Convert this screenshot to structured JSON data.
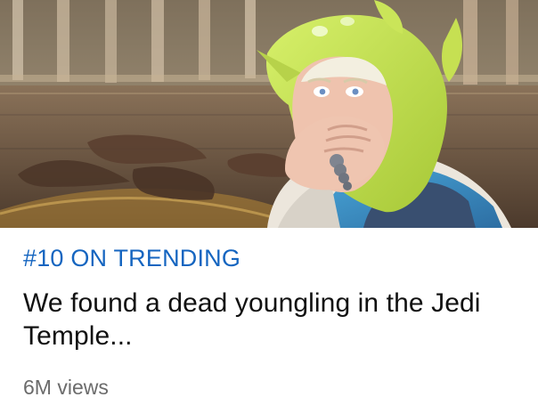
{
  "video_card": {
    "trending_label": "#10 ON TRENDING",
    "title": "We found a dead youngling in the Jedi Temple...",
    "views": "6M views"
  },
  "colors": {
    "trending_blue": "#1565c0",
    "title_text": "#111111",
    "meta_text": "#6b6b6b",
    "background": "#ffffff"
  },
  "thumbnail": {
    "icon": "video-thumbnail-icon"
  }
}
